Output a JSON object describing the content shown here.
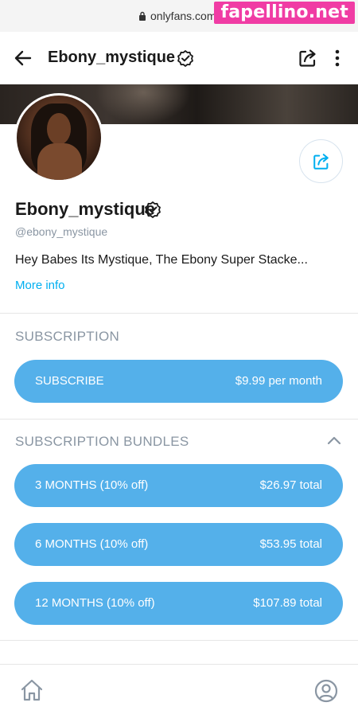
{
  "browser": {
    "url": "onlyfans.com",
    "watermark": "fapellino.net"
  },
  "topnav": {
    "title": "Ebony_mystique",
    "icons": [
      "back-arrow-icon",
      "verified-badge-icon",
      "share-icon",
      "more-vertical-icon"
    ]
  },
  "profile": {
    "name": "Ebony_mystique",
    "handle": "@ebony_mystique",
    "bio": "Hey Babes Its Mystique, The Ebony Super Stacke...",
    "more_info": "More info"
  },
  "subscription": {
    "title": "SUBSCRIPTION",
    "subscribe_label": "SUBSCRIBE",
    "subscribe_price": "$9.99 per month"
  },
  "bundles": {
    "title": "SUBSCRIPTION BUNDLES",
    "items": [
      {
        "label": "3 MONTHS (10% off)",
        "price": "$26.97 total"
      },
      {
        "label": "6 MONTHS (10% off)",
        "price": "$53.95 total"
      },
      {
        "label": "12 MONTHS (10% off)",
        "price": "$107.89 total"
      }
    ]
  },
  "colors": {
    "accent": "#00aff0",
    "button": "#54b0ea",
    "muted": "#8a96a3",
    "watermark": "#f03ca4"
  },
  "bottombar": {
    "icons": [
      "home-icon",
      "profile-icon"
    ]
  }
}
